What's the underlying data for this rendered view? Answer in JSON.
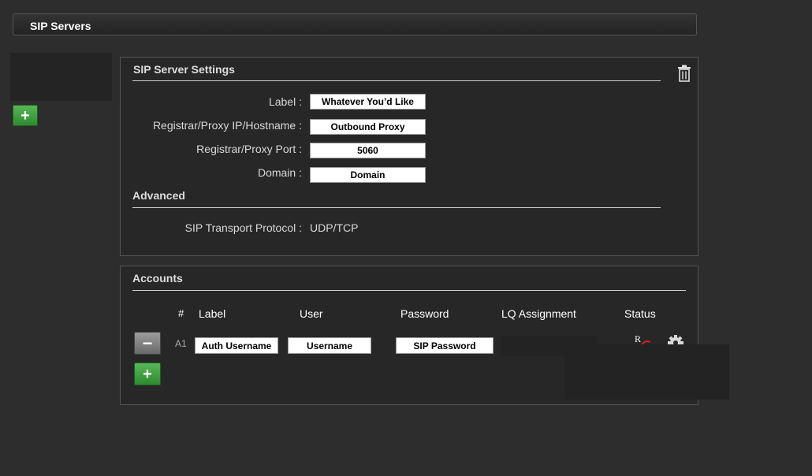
{
  "header": {
    "title": "SIP Servers"
  },
  "sidebar": {
    "add_label": "+"
  },
  "settings": {
    "title": "SIP Server Settings",
    "fields": [
      {
        "label": "Label :",
        "value": "Whatever You’d Like"
      },
      {
        "label": "Registrar/Proxy IP/Hostname :",
        "value": "Outbound Proxy"
      },
      {
        "label": "Registrar/Proxy Port :",
        "value": "5060"
      },
      {
        "label": "Domain :",
        "value": "Domain"
      }
    ],
    "advanced": {
      "title": "Advanced",
      "transport_label": "SIP Transport Protocol :",
      "transport_value": "UDP/TCP"
    }
  },
  "accounts": {
    "title": "Accounts",
    "columns": [
      "#",
      "Label",
      "User",
      "Password",
      "LQ Assignment",
      "Status"
    ],
    "rows": [
      {
        "id": "A1",
        "label": "Auth Username",
        "user": "Username",
        "password": "SIP Password",
        "lq_assignment": "",
        "status": "R"
      }
    ],
    "remove_label": "−",
    "add_label": "+"
  },
  "icons": {
    "delete": "trash-icon",
    "settings": "gear-icon"
  },
  "colors": {
    "add_button": "#3fa03f",
    "background": "#2d2d2d"
  }
}
